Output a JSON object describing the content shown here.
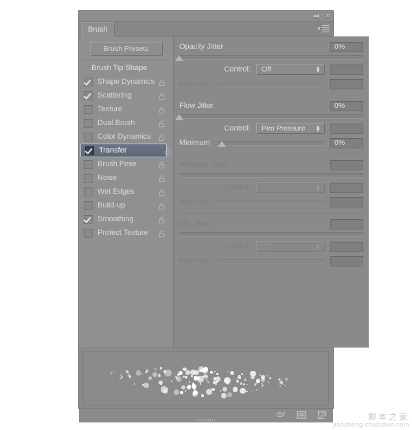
{
  "window": {
    "title": "Brush",
    "collapse_icon": "collapse-icon",
    "close_icon": "close-icon",
    "menu_icon": "panel-menu-icon",
    "collapse_glyph": "◂◂",
    "close_glyph": "✕"
  },
  "left": {
    "presets_button": "Brush Presets",
    "tip_shape": "Brush Tip Shape",
    "items": [
      {
        "label": "Shape Dynamics",
        "checked": true,
        "selected": false
      },
      {
        "label": "Scattering",
        "checked": true,
        "selected": false
      },
      {
        "label": "Texture",
        "checked": false,
        "selected": false
      },
      {
        "label": "Dual Brush",
        "checked": false,
        "selected": false
      },
      {
        "label": "Color Dynamics",
        "checked": false,
        "selected": false
      },
      {
        "label": "Transfer",
        "checked": true,
        "selected": true
      },
      {
        "label": "Brush Pose",
        "checked": false,
        "selected": false
      },
      {
        "label": "Noise",
        "checked": false,
        "selected": false
      },
      {
        "label": "Wet Edges",
        "checked": false,
        "selected": false
      },
      {
        "label": "Build-up",
        "checked": false,
        "selected": false
      },
      {
        "label": "Smoothing",
        "checked": true,
        "selected": false
      },
      {
        "label": "Protect Texture",
        "checked": false,
        "selected": false
      }
    ]
  },
  "right": {
    "groups": [
      {
        "title": "Opacity Jitter",
        "value": "0%",
        "enabled": true,
        "slider_pct": 0,
        "control_label": "Control:",
        "control_value": "Off",
        "control_enabled": true,
        "control_value_box": "",
        "minimum_label": "Minimum",
        "minimum_enabled": false,
        "minimum_value": "",
        "minimum_pct": 0
      },
      {
        "title": "Flow Jitter",
        "value": "0%",
        "enabled": true,
        "slider_pct": 0,
        "control_label": "Control:",
        "control_value": "Pen Pressure",
        "control_enabled": true,
        "control_value_box": "",
        "minimum_label": "Minimum",
        "minimum_enabled": true,
        "minimum_value": "0%",
        "minimum_pct": 0
      },
      {
        "title": "Wetness Jitter",
        "value": "",
        "enabled": false,
        "slider_pct": 0,
        "control_label": "Control:",
        "control_value": "Off",
        "control_enabled": false,
        "control_value_box": "",
        "minimum_label": "Minimum",
        "minimum_enabled": false,
        "minimum_value": "",
        "minimum_pct": 0
      },
      {
        "title": "Mix Jitter",
        "value": "",
        "enabled": false,
        "slider_pct": 0,
        "control_label": "Control:",
        "control_value": "Off",
        "control_enabled": false,
        "control_value_box": "",
        "minimum_label": "Minimum",
        "minimum_enabled": false,
        "minimum_value": "",
        "minimum_pct": 0
      }
    ]
  },
  "footer": {
    "toggle_pressure_icon": "brush-pressure-toggle-icon",
    "brush_panel_icon": "brush-presets-grid-icon",
    "new_brush_icon": "new-brush-icon",
    "resize_grip": "resize-grip"
  },
  "watermark": {
    "cn": "脚本之家",
    "en": "jiaocheng.chuzidian.com"
  },
  "colors": {
    "panel_bg": "#8a8a8a",
    "left_bg": "#909090",
    "selection": "#6d7687",
    "text": "#dedede",
    "text_disabled": "#7e7e7e"
  }
}
